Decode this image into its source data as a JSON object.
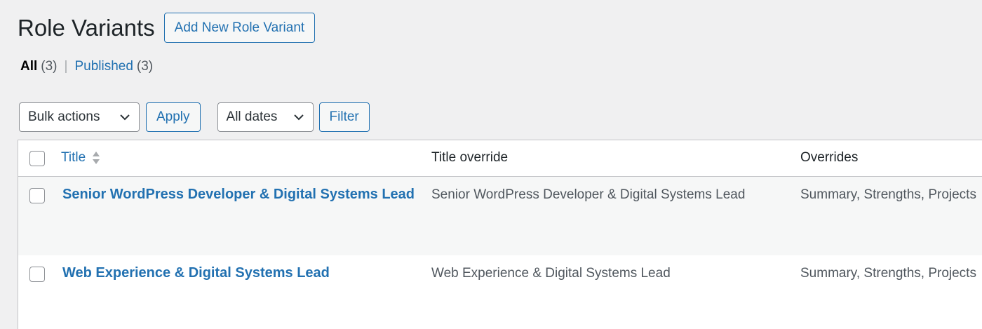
{
  "header": {
    "title": "Role Variants",
    "add_new_label": "Add New Role Variant"
  },
  "views": {
    "all_label": "All",
    "all_count": "(3)",
    "separator": "|",
    "published_label": "Published",
    "published_count": "(3)"
  },
  "tablenav": {
    "bulk_actions": "Bulk actions",
    "apply_label": "Apply",
    "dates": "All dates",
    "filter_label": "Filter"
  },
  "table": {
    "columns": {
      "title": "Title",
      "title_override": "Title override",
      "overrides": "Overrides"
    },
    "rows": [
      {
        "title": "Senior WordPress Developer & Digital Systems Lead",
        "title_override": "Senior WordPress Developer & Digital Systems Lead",
        "overrides": "Summary, Strengths, Projects"
      },
      {
        "title": "Web Experience & Digital Systems Lead",
        "title_override": "Web Experience & Digital Systems Lead",
        "overrides": "Summary, Strengths, Projects"
      }
    ]
  },
  "colors": {
    "accent": "#2271b1",
    "background": "#f0f0f1",
    "text": "#1d2327"
  },
  "icons": {
    "dropdown": "chevron-down-icon",
    "sort": "sort-icon"
  }
}
